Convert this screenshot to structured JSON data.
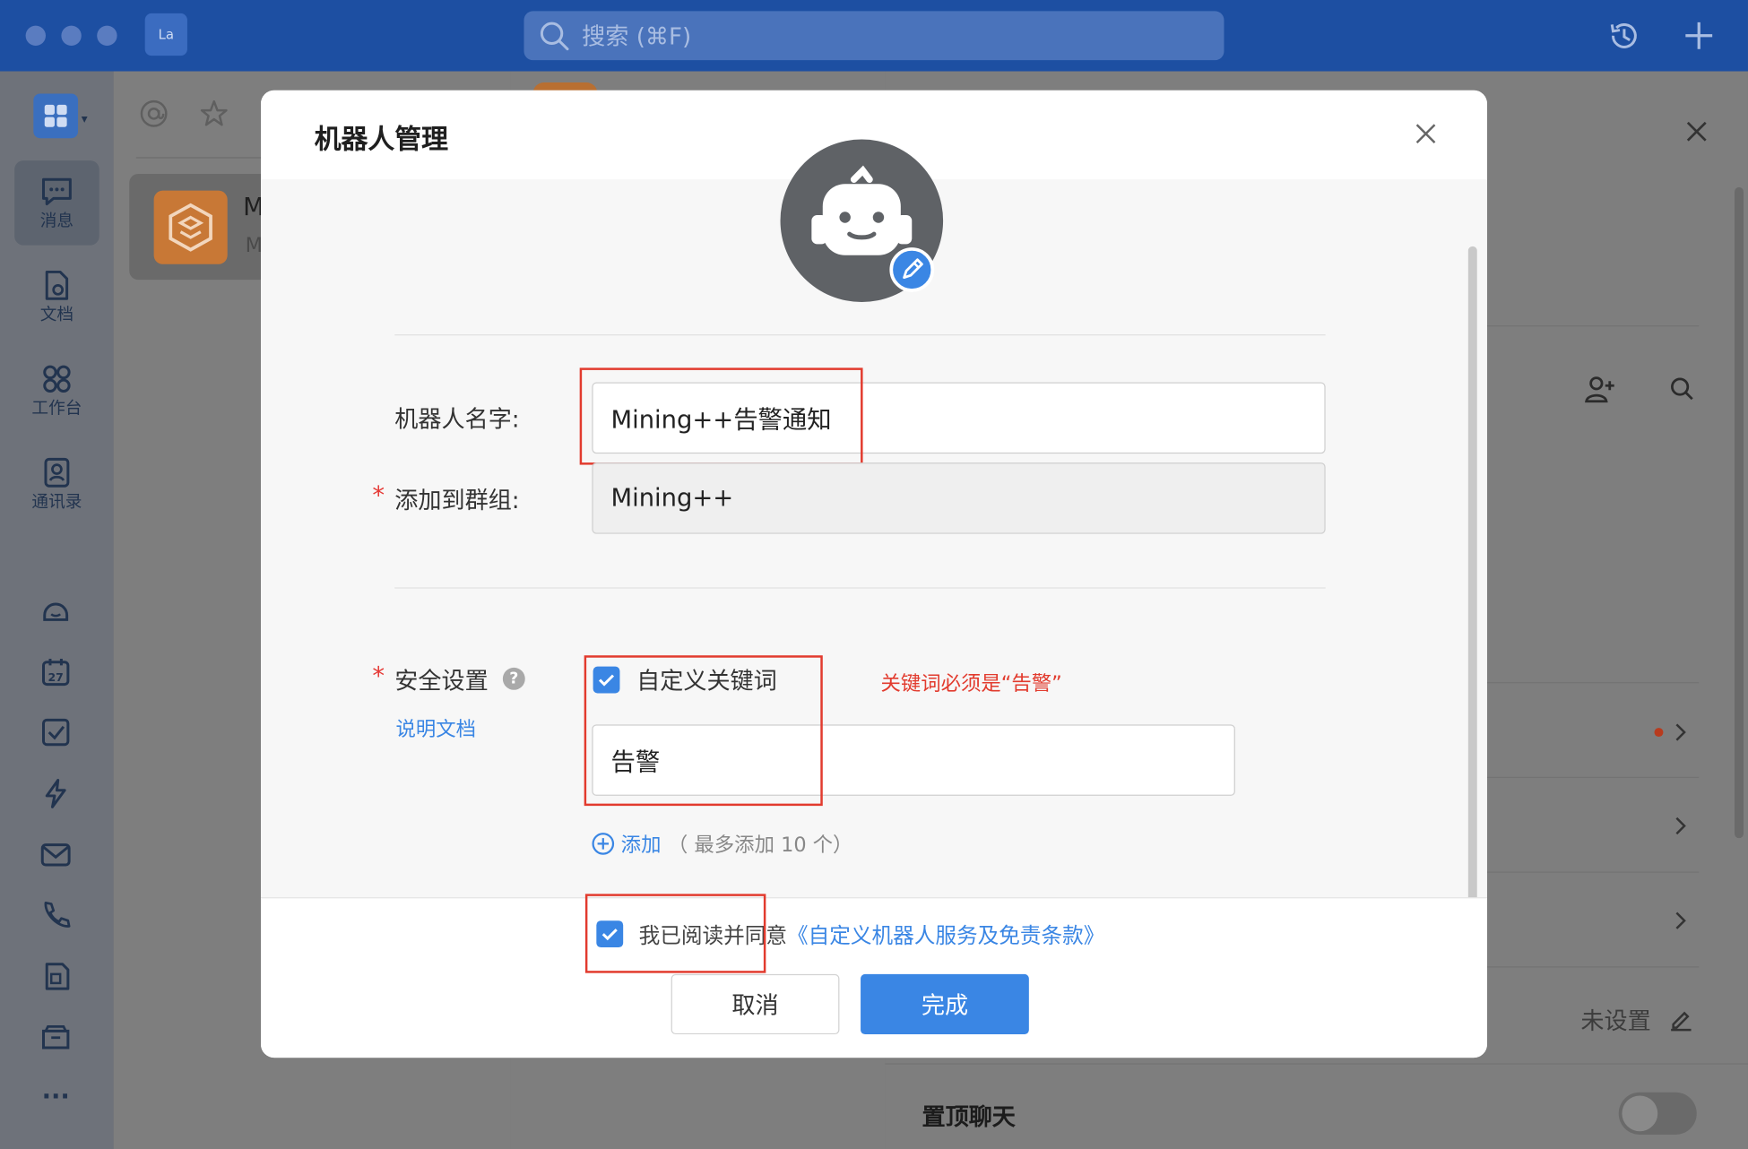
{
  "titlebar": {
    "app_logo_text": "La",
    "search_placeholder": "搜索 (⌘F)"
  },
  "leftnav": {
    "items": [
      {
        "label": "消息",
        "icon": "message-icon",
        "active": true
      },
      {
        "label": "文档",
        "icon": "document-icon"
      },
      {
        "label": "工作台",
        "icon": "workbench-icon"
      },
      {
        "label": "通讯录",
        "icon": "contacts-icon"
      }
    ],
    "more_label": "···"
  },
  "chatlist": {
    "first_item_initial": "M",
    "first_item_sub": "M"
  },
  "rightpanel": {
    "unset_label": "未设置",
    "pin_chat_label": "置顶聊天"
  },
  "modal": {
    "title": "机器人管理",
    "name_label": "机器人名字:",
    "name_value": "Mining++告警通知",
    "group_label": "添加到群组:",
    "group_value": "Mining++",
    "security_label": "安全设置",
    "doc_link": "说明文档",
    "keyword_checkbox_label": "自定义关键词",
    "keyword_note": "关键词必须是“告警”",
    "keyword_value": "告警",
    "add_link": "添加",
    "add_hint": "（ 最多添加 10 个）",
    "agree_text": "我已阅读并同意",
    "agree_link": "《自定义机器人服务及免责条款》",
    "cancel_label": "取消",
    "done_label": "完成"
  },
  "colors": {
    "accent": "#3a86e4",
    "titlebar": "#1d4fa2",
    "annotation_red": "#e23b2e"
  }
}
